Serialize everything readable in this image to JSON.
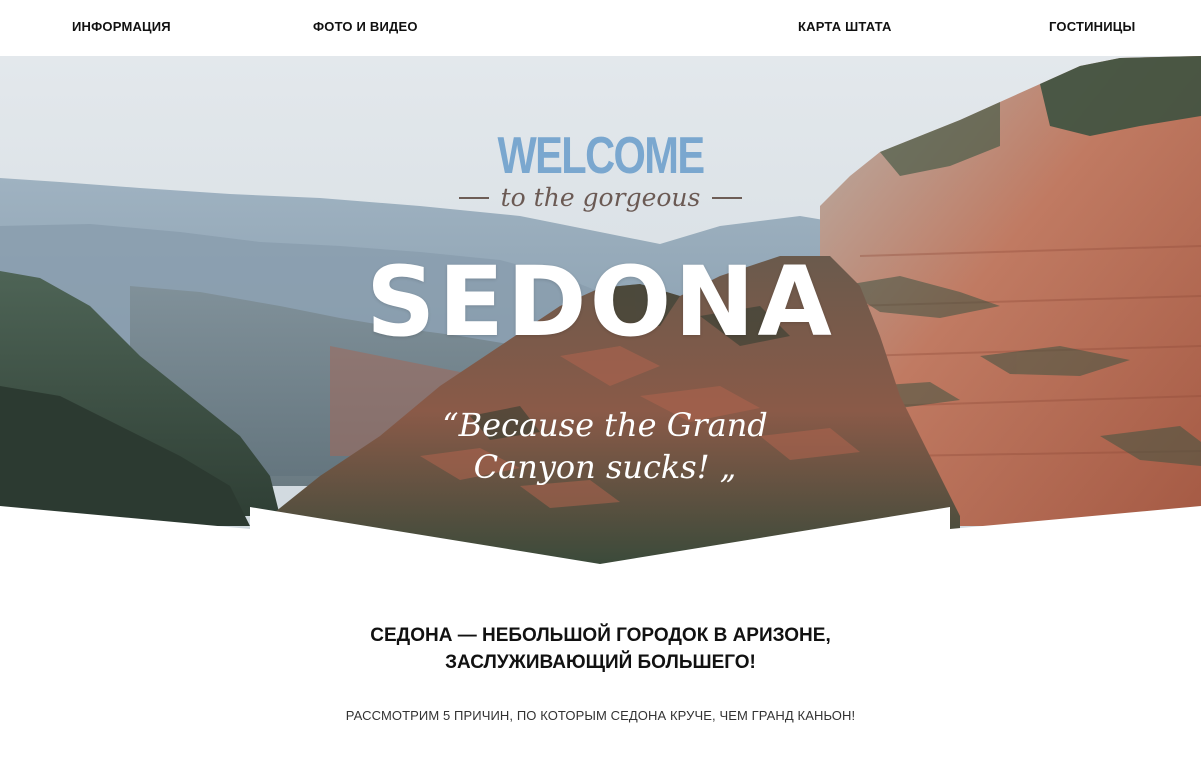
{
  "nav": {
    "items": [
      "ИНФОРМАЦИЯ",
      "ФОТО И ВИДЕО",
      "КАРТА ШТАТА",
      "ГОСТИНИЦЫ"
    ]
  },
  "hero": {
    "welcome": "WELCOME",
    "subtitle": "to the gorgeous",
    "title": "SEDONA",
    "quote_line1": "“Because the Grand",
    "quote_line2": "Canyon sucks! „"
  },
  "content": {
    "headline_line1": "СЕДОНА — НЕБОЛЬШОЙ ГОРОДОК В АРИЗОНЕ,",
    "headline_line2": "ЗАСЛУЖИВАЮЩИЙ БОЛЬШЕГО!",
    "subline": "РАССМОТРИМ 5 ПРИЧИН, ПО КОТОРЫМ СЕДОНА КРУЧЕ, ЧЕМ ГРАНД КАНЬОН!"
  },
  "colors": {
    "welcome": "#7aa7cf",
    "subtitle": "#6b5a54",
    "sky": "#d9e0e6",
    "red_rock": "#b86a52",
    "forest": "#3d4f3f"
  }
}
